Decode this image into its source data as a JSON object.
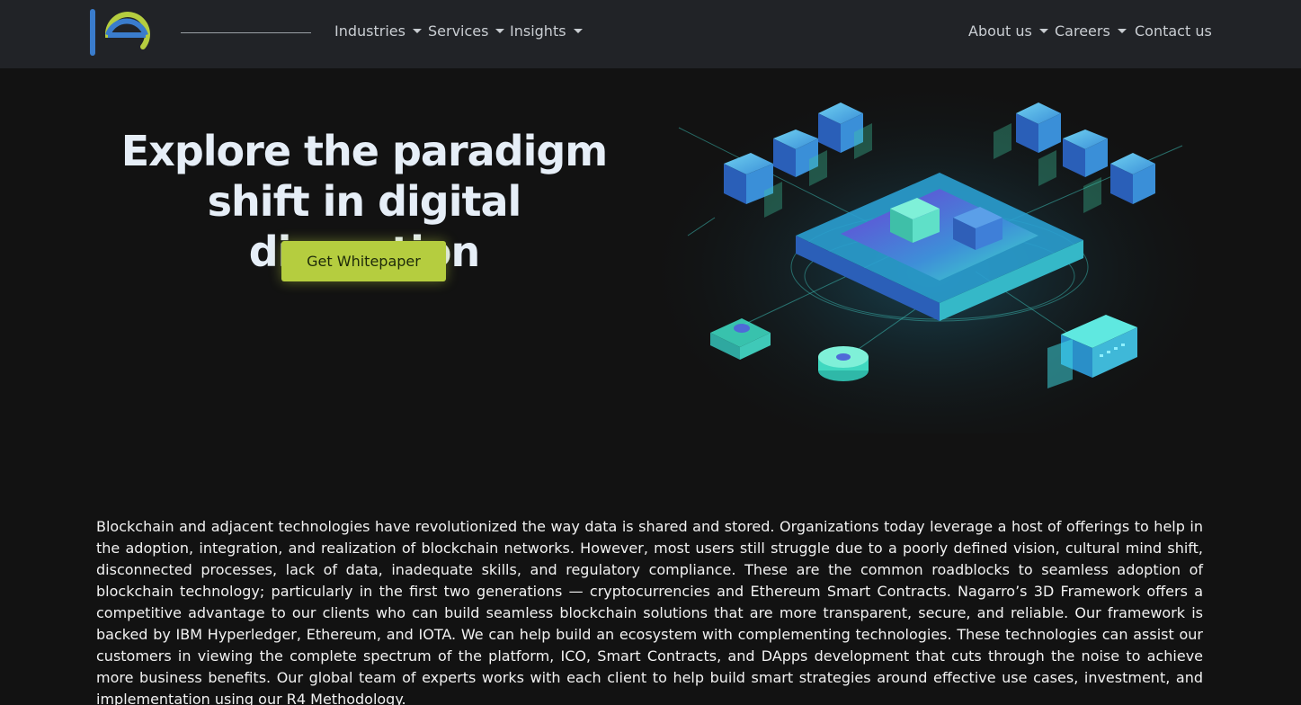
{
  "nav": {
    "logo_alt": "IE logo",
    "items": [
      {
        "label": "Industries",
        "dropdown": true
      },
      {
        "label": "Services",
        "dropdown": true
      },
      {
        "label": "Insights",
        "dropdown": true
      },
      {
        "label": "About us",
        "dropdown": true
      },
      {
        "label": "Careers",
        "dropdown": true
      },
      {
        "label": "Contact us",
        "dropdown": false
      }
    ]
  },
  "hero": {
    "title_line1": "Explore the paradigm",
    "title_line2": "shift in digital disruption",
    "cta_label": "Get Whitepaper",
    "illustration": "blockchain-isometric-illustration"
  },
  "body": {
    "paragraph": "Blockchain and adjacent technologies have revolutionized the way data is shared and stored. Organizations today leverage a host of offerings to help in the adoption, integration, and realization of blockchain networks. However, most users still struggle due to a poorly defined vision, cultural mind shift, disconnected processes, lack of data, inadequate skills, and regulatory compliance. These are the common roadblocks to seamless adoption of blockchain technology; particularly in the first two generations — cryptocurrencies and Ethereum Smart Contracts. Nagarro’s 3D Framework offers a competitive advantage to our clients who can build seamless blockchain solutions that are more transparent, secure, and reliable. Our framework is backed by IBM Hyperledger, Ethereum, and IOTA. We can help build an ecosystem with complementing technologies. These technologies can assist our customers in viewing the complete spectrum of the platform, ICO, Smart Contracts, and DApps development that cuts through the noise to achieve more business benefits. Our global team of experts works with each client to help build smart strategies around effective use cases, investment, and implementation using our R4 Methodology."
  },
  "colors": {
    "background": "#121212",
    "navbar": "#212327",
    "accent_green": "#b5cd3f",
    "logo_blue": "#3a7ccc",
    "logo_green": "#b5cd3f"
  }
}
